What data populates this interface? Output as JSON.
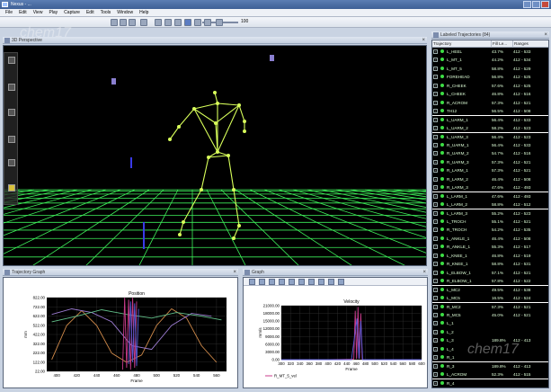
{
  "window": {
    "title": "Nexus - ...",
    "icon": "app-icon"
  },
  "menu": [
    "File",
    "Edit",
    "View",
    "Play",
    "Capture",
    "Edit",
    "Tools",
    "Window",
    "Help"
  ],
  "toolbar": {
    "zoom": "100",
    "icons": [
      "new-icon",
      "open-icon",
      "save-icon",
      "undo-icon",
      "skip-start-icon",
      "step-back-icon",
      "play-reverse-icon",
      "play-icon",
      "step-forward-icon",
      "skip-end-icon",
      "loop-icon"
    ]
  },
  "viewport": {
    "title": "3D Perspective",
    "grid_color": "#3ef05a",
    "skeleton_color": "#d8ff5a"
  },
  "graph_left": {
    "title": "Trajectory Graph",
    "chart_data": {
      "type": "line",
      "title": "Position",
      "xlabel": "Frame",
      "ylabel": "mm",
      "x_ticks": [
        400,
        420,
        440,
        460,
        480,
        500,
        520,
        540,
        560
      ],
      "y_ticks": [
        "822.00",
        "722.00",
        "622.00",
        "522.00",
        "422.00",
        "322.00",
        "222.00",
        "122.00",
        "22.00"
      ],
      "xlim": [
        390,
        570
      ],
      "ylim": [
        22,
        822
      ],
      "series": [
        {
          "color": "#d08a4a",
          "x": [
            395,
            410,
            425,
            440,
            455,
            470,
            485,
            500,
            515,
            530,
            545,
            560
          ],
          "y": [
            150,
            520,
            680,
            520,
            220,
            120,
            200,
            520,
            700,
            600,
            300,
            120
          ]
        },
        {
          "color": "#9b7bd0",
          "x": [
            395,
            415,
            435,
            455,
            475,
            495,
            515,
            535,
            555
          ],
          "y": [
            640,
            700,
            660,
            560,
            300,
            260,
            520,
            650,
            620
          ]
        },
        {
          "color": "#62c08a",
          "x": [
            395,
            420,
            445,
            470,
            495,
            520,
            545,
            565
          ],
          "y": [
            560,
            620,
            690,
            640,
            600,
            660,
            620,
            580
          ]
        },
        {
          "color": "#c83c8c",
          "x": [
            466,
            468,
            470,
            472,
            474,
            476,
            478,
            480
          ],
          "y": [
            40,
            820,
            60,
            800,
            40,
            820,
            60,
            780
          ]
        },
        {
          "color": "#5a5ad8",
          "x": [
            472,
            474,
            476,
            478,
            480,
            482
          ],
          "y": [
            100,
            780,
            120,
            760,
            80,
            700
          ]
        }
      ]
    }
  },
  "graph_right": {
    "title": "Graph",
    "legend": "R_MT_5_vel",
    "chart_data": {
      "type": "line",
      "title": "Velocity",
      "xlabel": "Frame",
      "ylabel": "mm/s",
      "x_ticks": [
        300,
        320,
        340,
        360,
        380,
        400,
        420,
        440,
        460,
        480,
        500,
        520,
        540,
        560,
        580,
        600
      ],
      "y_ticks": [
        "21000.00",
        "18000.00",
        "15000.00",
        "12000.00",
        "9000.00",
        "6000.00",
        "3000.00",
        "0.00"
      ],
      "xlim": [
        300,
        600
      ],
      "ylim": [
        0,
        21000
      ],
      "series": [
        {
          "name": "R_MT_5_vel",
          "color": "#c83c8c",
          "x": [
            300,
            400,
            455,
            458,
            461,
            464,
            467,
            470,
            473,
            476,
            600
          ],
          "y": [
            0,
            0,
            200,
            19000,
            300,
            20500,
            400,
            18000,
            200,
            0,
            0
          ]
        },
        {
          "color": "#5a5ad8",
          "x": [
            300,
            450,
            462,
            466,
            470,
            474,
            600
          ],
          "y": [
            0,
            0,
            16000,
            300,
            15000,
            0,
            0
          ]
        }
      ]
    }
  },
  "trajectories": {
    "title": "Labeled Trajectories (84)",
    "headers": [
      "Trajectory",
      "Fill Le...",
      "Ranges"
    ],
    "rows": [
      {
        "name": "L_HEEL",
        "fill": "43.7%",
        "range": "412 - 533"
      },
      {
        "name": "L_MT_1",
        "fill": "44.2%",
        "range": "412 - 534"
      },
      {
        "name": "L_MT_5",
        "fill": "58.8%",
        "range": "412 - 529"
      },
      {
        "name": "FOREHEAD",
        "fill": "56.8%",
        "range": "412 - 525"
      },
      {
        "name": "R_CHEEK",
        "fill": "57.6%",
        "range": "412 - 525"
      },
      {
        "name": "L_CHEEK",
        "fill": "46.8%",
        "range": "412 - 516"
      },
      {
        "name": "R_ACROM",
        "fill": "57.3%",
        "range": "412 - 521"
      },
      {
        "name": "TH12",
        "fill": "56.5%",
        "range": "412 - 508"
      },
      {
        "name": "L_UARM_1",
        "fill": "56.4%",
        "range": "412 - 533"
      },
      {
        "name": "L_UARM_2",
        "fill": "58.2%",
        "range": "412 - 523"
      },
      {
        "name": "L_UARM_3",
        "fill": "56.4%",
        "range": "412 - 523"
      },
      {
        "name": "R_UARM_1",
        "fill": "56.4%",
        "range": "412 - 533"
      },
      {
        "name": "R_UARM_2",
        "fill": "54.7%",
        "range": "412 - 516"
      },
      {
        "name": "R_UARM_3",
        "fill": "57.3%",
        "range": "412 - 521"
      },
      {
        "name": "R_LARM_1",
        "fill": "57.3%",
        "range": "412 - 521"
      },
      {
        "name": "R_LARM_2",
        "fill": "46.4%",
        "range": "412 - 508"
      },
      {
        "name": "R_LARM_3",
        "fill": "47.6%",
        "range": "412 - 493"
      },
      {
        "name": "L_LARM_1",
        "fill": "47.6%",
        "range": "412 - 493"
      },
      {
        "name": "L_LARM_2",
        "fill": "58.8%",
        "range": "412 - 512"
      },
      {
        "name": "L_LARM_3",
        "fill": "55.2%",
        "range": "412 - 523"
      },
      {
        "name": "L_TROCH",
        "fill": "55.1%",
        "range": "412 - 521"
      },
      {
        "name": "R_TROCH",
        "fill": "54.2%",
        "range": "412 - 535"
      },
      {
        "name": "L_ANKLE_1",
        "fill": "46.4%",
        "range": "412 - 508"
      },
      {
        "name": "R_ANKLE_1",
        "fill": "55.3%",
        "range": "412 - 517"
      },
      {
        "name": "L_KNEE_1",
        "fill": "46.8%",
        "range": "412 - 519"
      },
      {
        "name": "R_KNEE_1",
        "fill": "58.8%",
        "range": "412 - 531"
      },
      {
        "name": "L_ELBOW_1",
        "fill": "57.1%",
        "range": "412 - 521"
      },
      {
        "name": "R_ELBOW_1",
        "fill": "57.8%",
        "range": "412 - 522"
      },
      {
        "name": "L_MC2",
        "fill": "49.5%",
        "range": "412 - 538"
      },
      {
        "name": "L_MC5",
        "fill": "16.5%",
        "range": "412 - 524"
      },
      {
        "name": "R_MC2",
        "fill": "57.3%",
        "range": "412 - 521"
      },
      {
        "name": "R_MC5",
        "fill": "45.0%",
        "range": "412 - 521"
      },
      {
        "name": "L_1",
        "fill": "",
        "range": ""
      },
      {
        "name": "L_2",
        "fill": "",
        "range": ""
      },
      {
        "name": "L_3",
        "fill": "189.8%",
        "range": "412 - 413"
      },
      {
        "name": "L_4",
        "fill": "",
        "range": ""
      },
      {
        "name": "R_1",
        "fill": "",
        "range": ""
      },
      {
        "name": "R_3",
        "fill": "189.8%",
        "range": "412 - 413"
      },
      {
        "name": "L_ACROM",
        "fill": "52.3%",
        "range": "412 - 515"
      },
      {
        "name": "R_4",
        "fill": "",
        "range": ""
      }
    ]
  }
}
